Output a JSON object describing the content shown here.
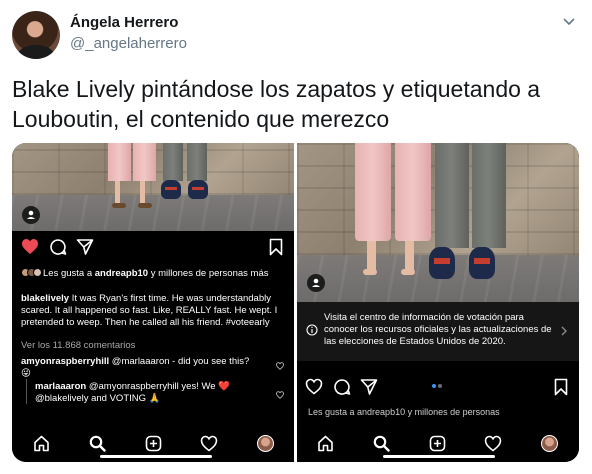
{
  "tweet": {
    "author_name": "Ángela Herrero",
    "author_handle": "@_angelaherrero",
    "text": "Blake Lively pintándose los zapatos y etiquetando a Louboutin, el contenido que merezco"
  },
  "left_post": {
    "likes_prefix": "Les gusta a ",
    "likes_user": "andreapb10",
    "likes_suffix": " y millones de personas más",
    "caption_user": "blakelively",
    "caption_text": " It was Ryan's first time. He was understandably scared. It all happened so fast. Like, REALLY fast. He wept. I pretended to weep. Then he called all his friend. #voteearly",
    "view_comments": "Ver los 11.868 comentarios",
    "comments": [
      {
        "user": "amyonraspberryhill",
        "text": " @marlaaaron - did you see this?",
        "emoji": "😜"
      },
      {
        "user": "marlaaaron",
        "text": " @amyonraspberryhill yes! We ",
        "heart": "❤️",
        "text2": " @blakelively  and VOTING ",
        "emoji": "🙏"
      }
    ]
  },
  "right_post": {
    "info_text": "Visita el centro de información de votación para conocer los recursos oficiales y las actualizaciones de las elecciones de Estados Unidos de 2020.",
    "partial_likes": "Les gusta a andreapb10 y millones de personas"
  },
  "icons": [
    "chevron-down-icon",
    "heart-icon",
    "comment-icon",
    "share-icon",
    "bookmark-icon",
    "person-tag-icon",
    "home-icon",
    "search-icon",
    "new-post-icon",
    "activity-heart-icon",
    "profile-avatar-icon",
    "info-icon",
    "chevron-right-icon"
  ],
  "colors": {
    "like_red": "#ed4956",
    "name_text": "#14171a",
    "handle_grey": "#657786",
    "carousel_dot_active": "#3897f0"
  }
}
